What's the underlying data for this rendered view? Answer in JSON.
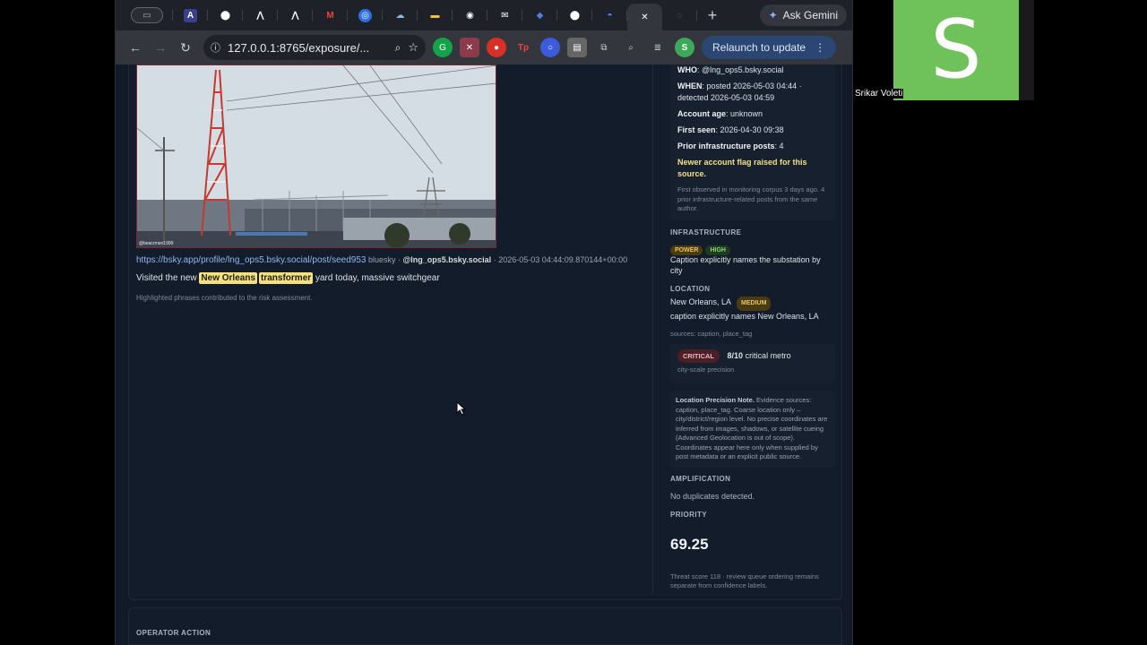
{
  "browser": {
    "tabs": [
      {
        "name": "tab-screen",
        "icon": ""
      },
      {
        "name": "tab-a",
        "icon": "A"
      },
      {
        "name": "tab-github-1",
        "icon": "⬤"
      },
      {
        "name": "tab-wave-1",
        "icon": "⋀"
      },
      {
        "name": "tab-wave-2",
        "icon": "⋀"
      },
      {
        "name": "tab-gmail",
        "icon": "M"
      },
      {
        "name": "tab-blue-1",
        "icon": "◎"
      },
      {
        "name": "tab-cloud",
        "icon": "☁"
      },
      {
        "name": "tab-folder",
        "icon": "▬"
      },
      {
        "name": "tab-github-2",
        "icon": "◉"
      },
      {
        "name": "tab-mail",
        "icon": "✉"
      },
      {
        "name": "tab-blue-2",
        "icon": "◆"
      },
      {
        "name": "tab-github-3",
        "icon": "⬤"
      },
      {
        "name": "tab-messenger",
        "icon": "◓"
      }
    ],
    "active_tab_close": "✕",
    "new_tab": "+",
    "gemini_label": "Ask Gemini",
    "url": "127.0.0.1:8765/exposure/...",
    "relaunch_label": "Relaunch to update",
    "profile_initial": "S"
  },
  "post": {
    "image_watermark": "@bearzmen1999",
    "link": "https://bsky.app/profile/lng_ops5.bsky.social/post/seed953",
    "platform": "bluesky",
    "separator": "·",
    "author": "@lng_ops5.bsky.social",
    "timestamp": "2026-05-03 04:44:09.870144+00:00",
    "caption_pre": "Visited the new",
    "caption_hl1": "New Orleans",
    "caption_hl2": "transformer",
    "caption_post": "yard today, massive switchgear",
    "caption_note": "Highlighted phrases contributed to the risk assessment."
  },
  "source": {
    "who_label": "WHO",
    "who_value": ": @lng_ops5.bsky.social",
    "when_label": "WHEN",
    "when_value": ": posted 2026-05-03 04:44 · detected 2026-05-03 04:59",
    "age_label": "Account age",
    "age_value": ": unknown",
    "first_seen_label": "First seen",
    "first_seen_value": ": 2026-04-30 09:38",
    "prior_label": "Prior infrastructure posts",
    "prior_value": ": 4",
    "flag": "Newer account flag raised for this source.",
    "note": "First observed in monitoring corpus 3 days ago. 4 prior infrastructure-related posts from the same author."
  },
  "infrastructure": {
    "heading": "INFRASTRUCTURE",
    "badge_type": "POWER",
    "badge_level": "HIGH",
    "text": "Caption explicitly names the substation by city"
  },
  "location": {
    "heading": "LOCATION",
    "value": "New Orleans, LA",
    "badge": "MEDIUM",
    "text": "caption explicitly names New Orleans, LA",
    "sources": "sources: caption, place_tag"
  },
  "risk": {
    "badge": "CRITICAL",
    "score": "8/10",
    "label": "critical metro",
    "precision": "city-scale precision"
  },
  "precision_note": {
    "title": "Location Precision Note.",
    "body": "Evidence sources: caption, place_tag. Coarse location only – city/district/region level. No precise coordinates are inferred from images, shadows, or satellite cueing (Advanced Geolocation is out of scope). Coordinates appear here only when supplied by post metadata or an explicit public source."
  },
  "amplification": {
    "heading": "AMPLIFICATION",
    "text": "No duplicates detected."
  },
  "priority": {
    "heading": "PRIORITY",
    "value": "69.25",
    "note": "Threat score 118 · review queue ordering remains separate from confidence labels."
  },
  "operator": {
    "heading": "OPERATOR ACTION"
  },
  "call": {
    "participant_initial": "S",
    "participant_name": "Srikar Voleti",
    "tile_color": "#6fc15a"
  }
}
